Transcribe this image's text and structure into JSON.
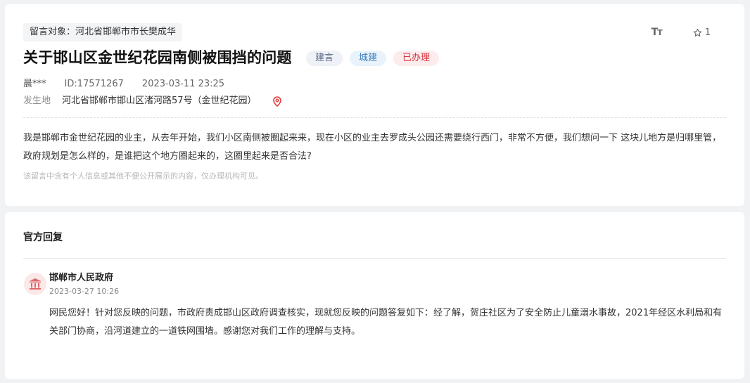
{
  "message": {
    "target_label": "留言对象：河北省邯郸市市长樊成华",
    "title": "关于邯山区金世纪花园南侧被围挡的问题",
    "tags": {
      "type": "建言",
      "category": "城建",
      "status": "已办理"
    },
    "tools": {
      "font_size_icon": "Tт",
      "favorite_count": "1"
    },
    "author": "晨***",
    "id": "ID:17571267",
    "datetime": "2023-03-11 23:25",
    "location_label": "发生地",
    "location_value": "河北省邯郸市邯山区渚河路57号（金世纪花园）",
    "content": "我是邯郸市金世纪花园的业主，从去年开始，我们小区南侧被圈起来来，现在小区的业主去罗成头公园还需要绕行西门，非常不方便，我们想问一下 这块儿地方是归哪里管，政府规划是怎么样的，是谁把这个地方圈起来的，这圈里起来是否合法?",
    "privacy_note": "该留言中含有个人信息或其他不便公开展示的内容，仅办理机构可见。"
  },
  "reply": {
    "heading": "官方回复",
    "org_name": "邯郸市人民政府",
    "datetime": "2023-03-27 10:26",
    "content": "网民您好！针对您反映的问题，市政府责成邯山区政府调查核实，现就您反映的问题答复如下：经了解，贺庄社区为了安全防止儿童溺水事故，2021年经区水利局和有关部门协商，沿河道建立的一道铁网围墙。感谢您对我们工作的理解与支持。"
  },
  "colors": {
    "status_red": "#d6353f",
    "category_blue": "#3d7fb8",
    "pin_red": "#e04040"
  },
  "icons": {
    "font_size": "font-size-icon",
    "favorite": "star-outline-icon",
    "location": "location-pin-icon",
    "organization": "government-building-icon"
  }
}
